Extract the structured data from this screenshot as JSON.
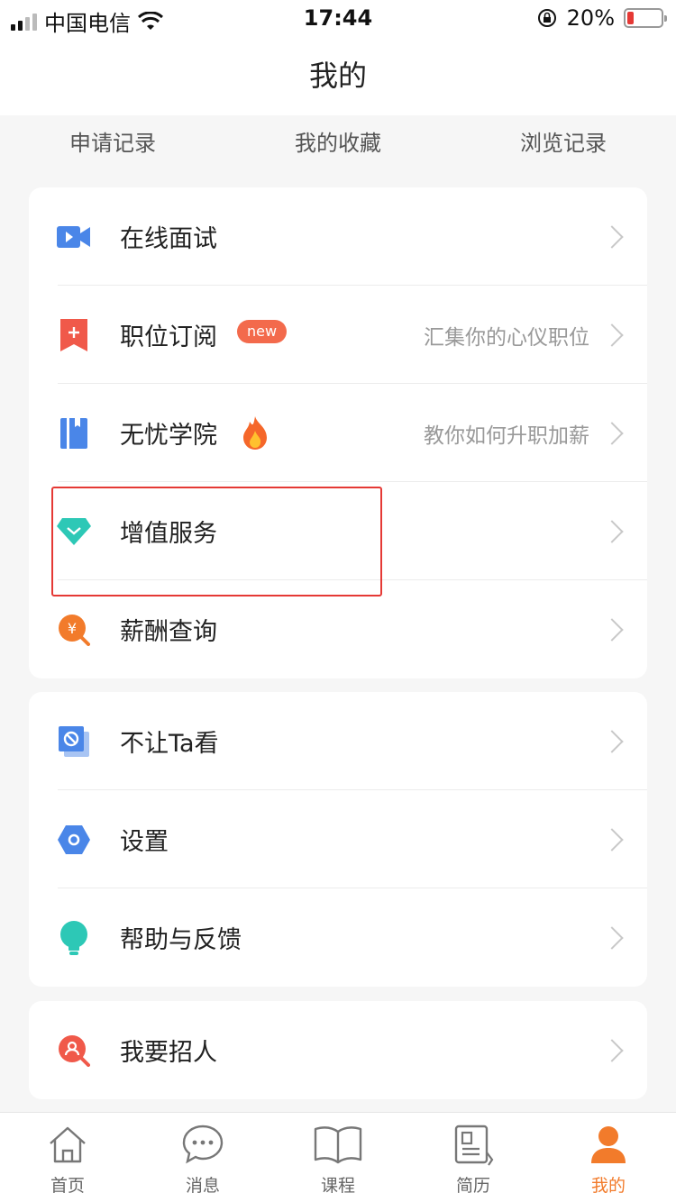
{
  "status_bar": {
    "carrier": "中国电信",
    "time": "17:44",
    "battery": "20%",
    "battery_level": 0.2
  },
  "header": {
    "title": "我的"
  },
  "quick_links": [
    {
      "label": "申请记录"
    },
    {
      "label": "我的收藏"
    },
    {
      "label": "浏览记录"
    }
  ],
  "menu_group_1": [
    {
      "label": "在线面试",
      "icon": "video-camera-icon",
      "hint": ""
    },
    {
      "label": "职位订阅",
      "icon": "bookmark-add-icon",
      "badge": "new",
      "hint": "汇集你的心仪职位"
    },
    {
      "label": "无忧学院",
      "icon": "book-icon",
      "hint": "教你如何升职加薪"
    },
    {
      "label": "增值服务",
      "icon": "diamond-icon",
      "hint": ""
    },
    {
      "label": "薪酬查询",
      "icon": "salary-search-icon",
      "hint": ""
    }
  ],
  "menu_group_2": [
    {
      "label": "不让Ta看",
      "icon": "block-icon"
    },
    {
      "label": "设置",
      "icon": "settings-hexagon-icon"
    },
    {
      "label": "帮助与反馈",
      "icon": "lightbulb-icon"
    }
  ],
  "menu_group_3": [
    {
      "label": "我要招人",
      "icon": "recruit-person-icon"
    }
  ],
  "tab_bar": [
    {
      "label": "首页",
      "icon": "home-icon"
    },
    {
      "label": "消息",
      "icon": "chat-icon"
    },
    {
      "label": "课程",
      "icon": "open-book-icon"
    },
    {
      "label": "简历",
      "icon": "resume-icon"
    },
    {
      "label": "我的",
      "icon": "person-icon",
      "active": true
    }
  ],
  "colors": {
    "accent": "#f27b2b",
    "highlight_border": "#e53935",
    "badge": "#f36a4c"
  }
}
